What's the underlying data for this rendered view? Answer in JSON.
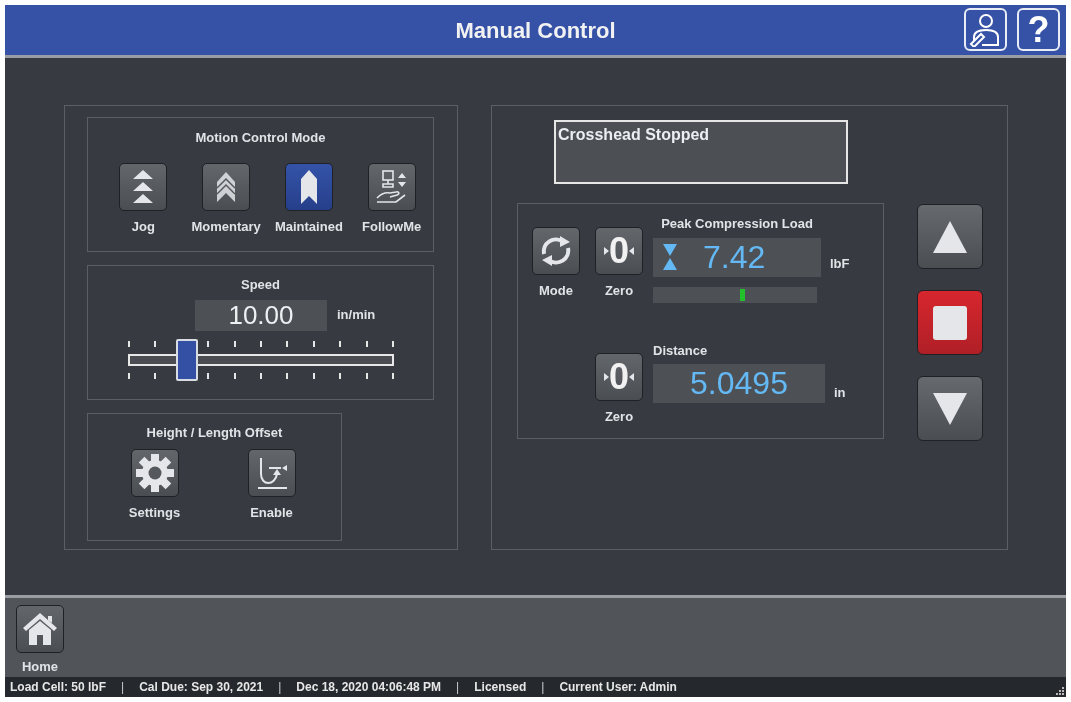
{
  "window": {
    "title": "Manual Control",
    "help_symbol": "?"
  },
  "motion_control": {
    "title": "Motion Control Mode",
    "modes": [
      {
        "label": "Jog",
        "kind": "jog",
        "selected": false
      },
      {
        "label": "Momentary",
        "kind": "momentary",
        "selected": false
      },
      {
        "label": "Maintained",
        "kind": "maintained",
        "selected": true
      },
      {
        "label": "FollowMe",
        "kind": "followme",
        "selected": false
      }
    ]
  },
  "speed": {
    "title": "Speed",
    "value": "10.00",
    "unit": "in/min",
    "level": 0.22
  },
  "offset": {
    "title": "Height / Length Offset",
    "buttons": [
      {
        "label": "Settings",
        "kind": "settings"
      },
      {
        "label": "Enable",
        "kind": "enable"
      }
    ]
  },
  "status_message": "Crosshead Stopped",
  "load": {
    "title": "Peak Compression Load",
    "value": "7.42",
    "unit": "lbF",
    "mode_label": "Mode",
    "zero_symbol": "0",
    "zero_label": "Zero",
    "level": 0.53
  },
  "distance": {
    "title": "Distance",
    "value": "5.0495",
    "unit": "in",
    "zero_symbol": "0",
    "zero_label": "Zero"
  },
  "footer": {
    "home_label": "Home"
  },
  "status_bar": [
    {
      "kind": "text",
      "text": "Load Cell: 50 lbF"
    },
    {
      "kind": "separator",
      "text": "|"
    },
    {
      "kind": "text",
      "text": "Cal Due: Sep 30, 2021"
    },
    {
      "kind": "separator",
      "text": "|"
    },
    {
      "kind": "text",
      "text": "Dec 18, 2020 04:06:48 PM"
    },
    {
      "kind": "separator",
      "text": "|"
    },
    {
      "kind": "text",
      "text": "Licensed"
    },
    {
      "kind": "separator",
      "text": "|"
    },
    {
      "kind": "text",
      "text": "Current User: Admin"
    }
  ]
}
